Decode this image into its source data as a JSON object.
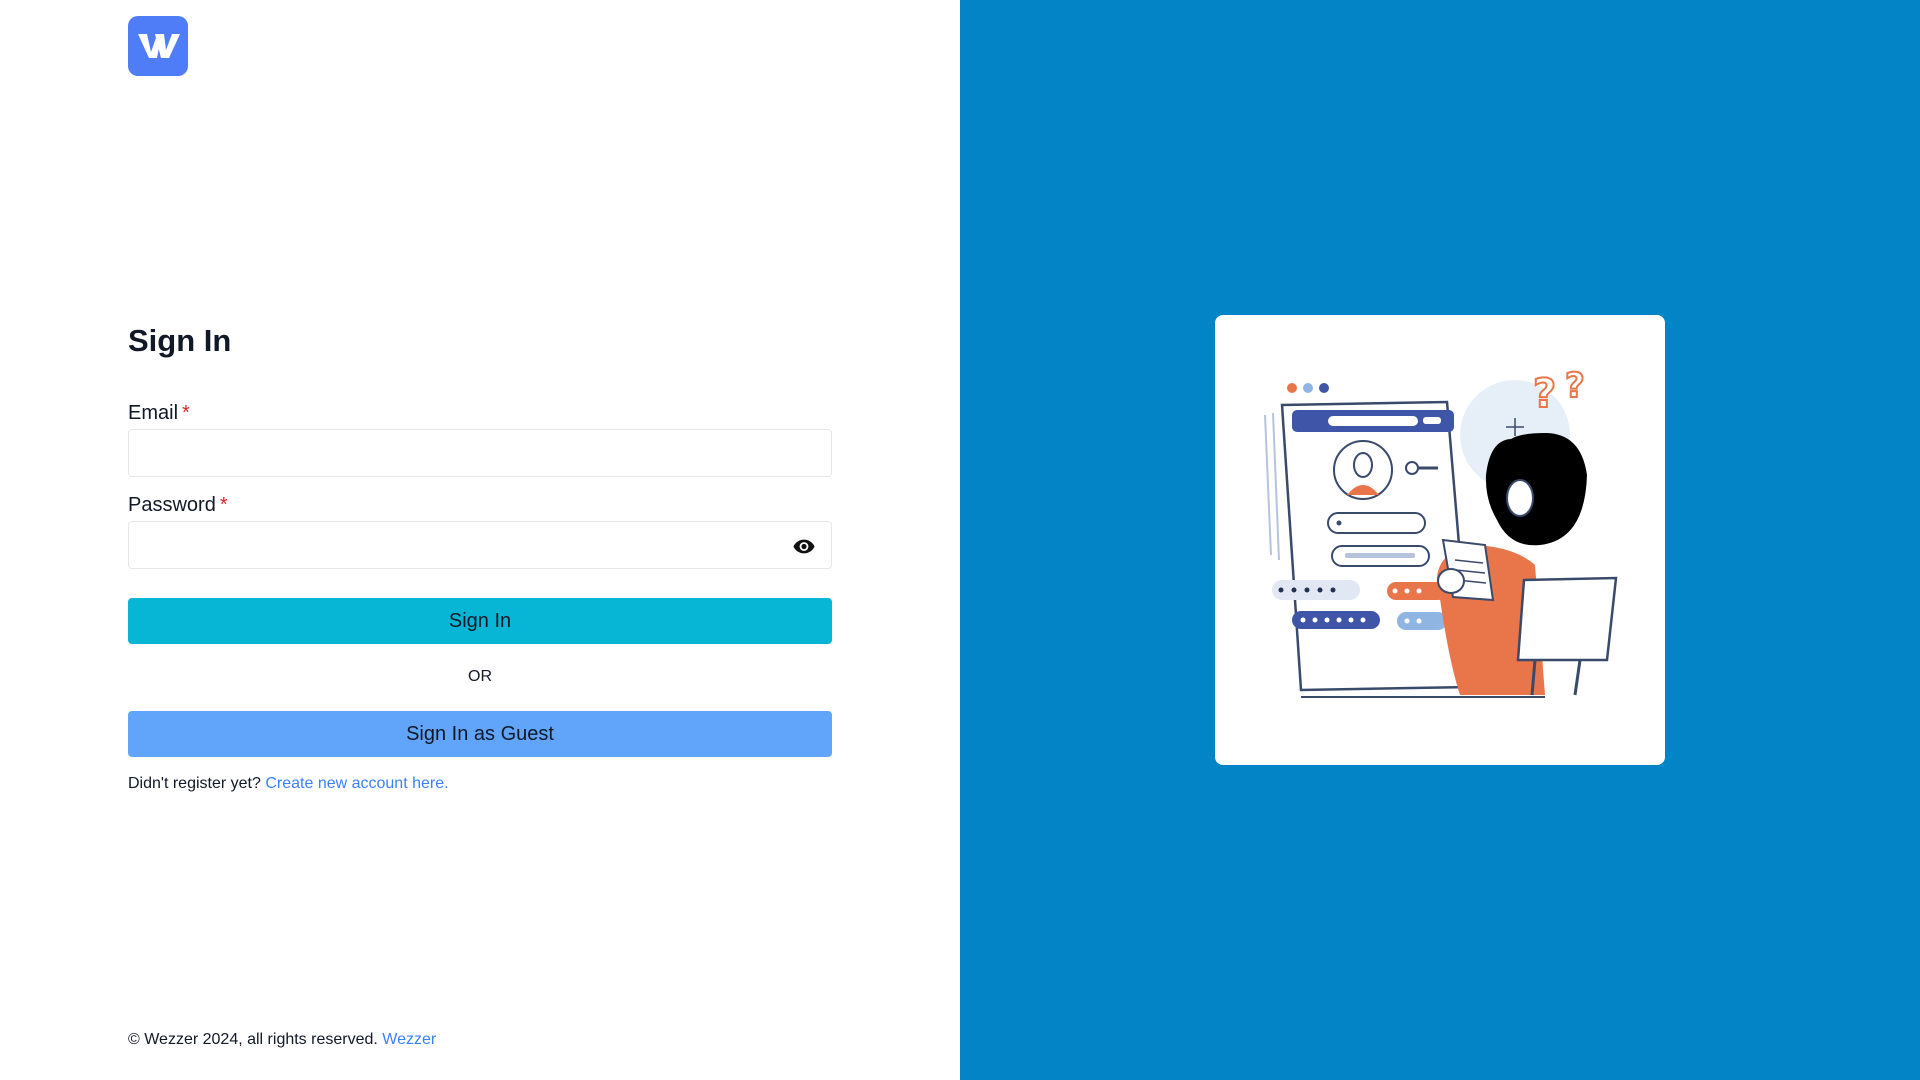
{
  "brand": {
    "logo_icon": "wezzer-logo",
    "accent": "#4f7cf7"
  },
  "signin": {
    "title": "Sign In",
    "email_label": "Email",
    "password_label": "Password",
    "required_mark": "*",
    "email_value": "",
    "password_value": "",
    "password_toggle_icon": "eye-icon",
    "submit_label": "Sign In",
    "divider_label": "OR",
    "guest_label": "Sign In as Guest",
    "register_text": "Didn't register yet?",
    "register_link": "Create new account here."
  },
  "footer": {
    "copyright": "© Wezzer 2024, all rights reserved.",
    "brand_link": "Wezzer"
  },
  "colors": {
    "right_panel": "#0284c7",
    "signin_button": "#06b6d4",
    "guest_button": "#60a5fa",
    "link": "#3b82f6",
    "required": "#dc2626"
  }
}
